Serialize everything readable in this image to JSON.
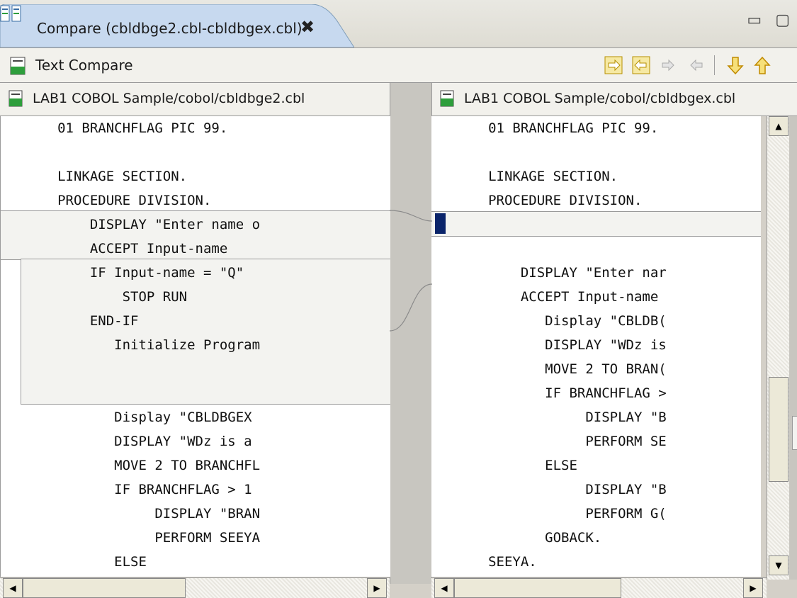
{
  "tab": {
    "title": "Compare (cbldbge2.cbl-cbldbgex.cbl)",
    "close": "✖"
  },
  "window_buttons": "▭ ▢",
  "toolbar": {
    "title": "Text Compare"
  },
  "left": {
    "path": "LAB1 COBOL Sample/cobol/cbldbge2.cbl",
    "lines": [
      "       01 BRANCHFLAG PIC 99.",
      "",
      "       LINKAGE SECTION.",
      "       PROCEDURE DIVISION.",
      "           DISPLAY \"Enter name o",
      "           ACCEPT Input-name",
      "           IF Input-name = \"Q\"",
      "               STOP RUN",
      "           END-IF",
      "              Initialize Program",
      "",
      "",
      "              Display \"CBLDBGEX",
      "              DISPLAY \"WDz is a",
      "              MOVE 2 TO BRANCHFL",
      "              IF BRANCHFLAG > 1",
      "                   DISPLAY \"BRAN",
      "                   PERFORM SEEYA",
      "              ELSE"
    ]
  },
  "right": {
    "path": "LAB1 COBOL Sample/cobol/cbldbgex.cbl",
    "lines": [
      "       01 BRANCHFLAG PIC 99.",
      "",
      "       LINKAGE SECTION.",
      "       PROCEDURE DIVISION.",
      "",
      "",
      "           DISPLAY \"Enter nar",
      "           ACCEPT Input-name",
      "              Display \"CBLDB(",
      "              DISPLAY \"WDz is",
      "              MOVE 2 TO BRAN(",
      "              IF BRANCHFLAG >",
      "                   DISPLAY \"B",
      "                   PERFORM SE",
      "              ELSE",
      "                   DISPLAY \"B",
      "                   PERFORM G(",
      "              GOBACK.",
      "       SEEYA."
    ]
  },
  "colors": {
    "diff_block": "#f3f3f0",
    "selection_marker": "#0a246a"
  },
  "icons": [
    "compare-editor-icon",
    "close-icon",
    "copy-all-left-to-right-icon",
    "copy-all-right-to-left-icon",
    "copy-current-left-to-right-icon",
    "copy-current-right-to-left-icon",
    "next-difference-icon",
    "previous-difference-icon",
    "file-icon"
  ]
}
